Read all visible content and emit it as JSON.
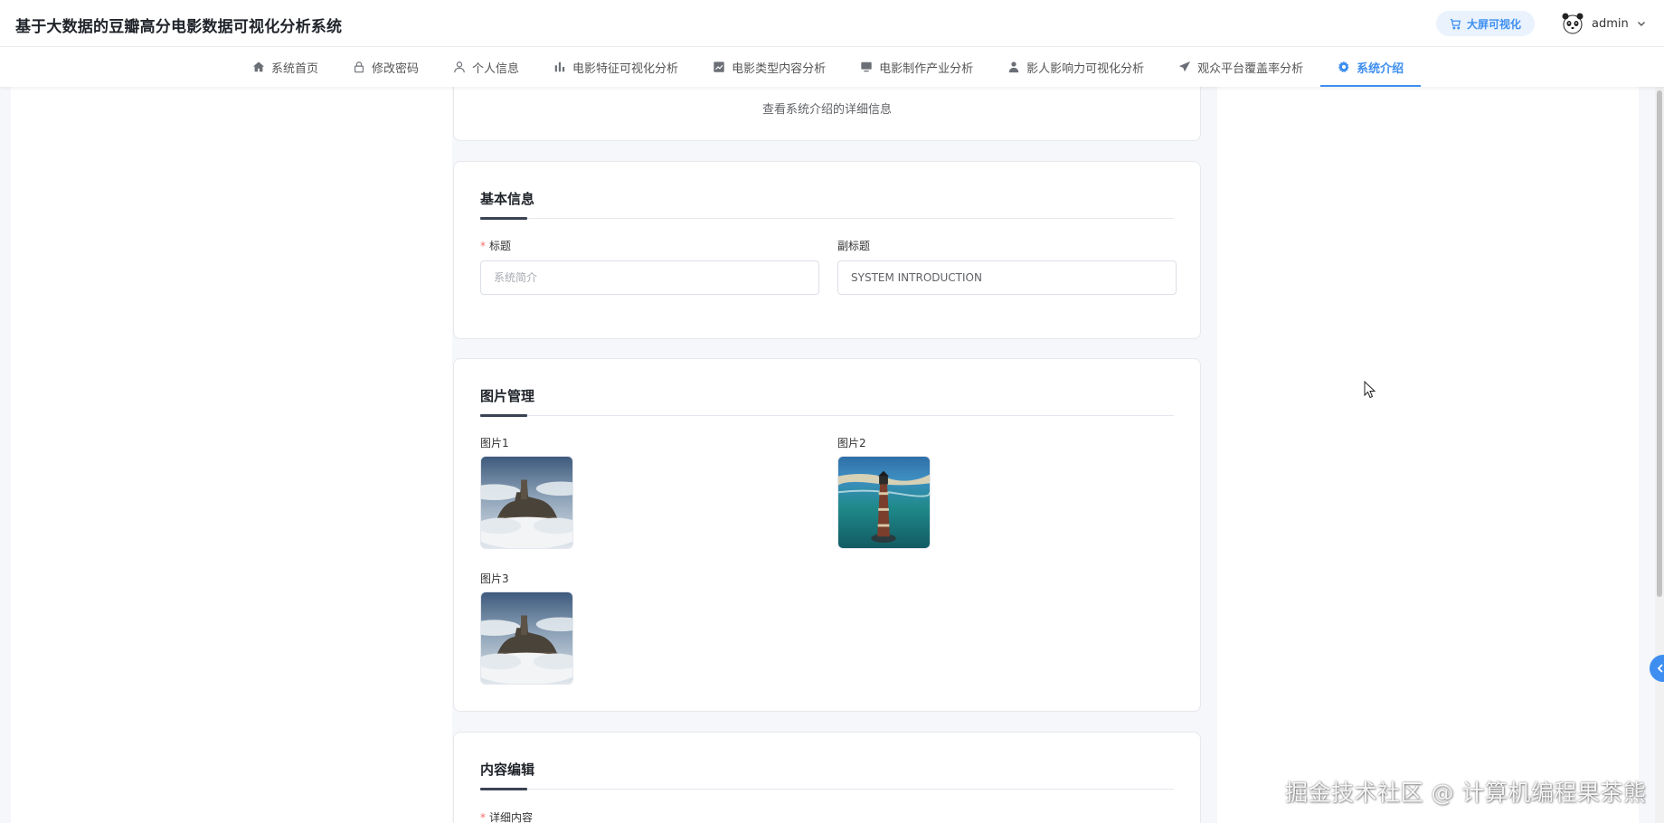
{
  "header": {
    "app_title": "基于大数据的豆瓣高分电影数据可视化分析系统",
    "bigscreen_label": "大屏可视化",
    "username": "admin"
  },
  "nav": {
    "items": [
      {
        "label": "系统首页",
        "icon": "home-icon"
      },
      {
        "label": "修改密码",
        "icon": "lock-icon"
      },
      {
        "label": "个人信息",
        "icon": "user-icon"
      },
      {
        "label": "电影特征可视化分析",
        "icon": "bar-chart-icon"
      },
      {
        "label": "电影类型内容分析",
        "icon": "trend-chart-icon"
      },
      {
        "label": "电影制作产业分析",
        "icon": "monitor-icon"
      },
      {
        "label": "影人影响力可视化分析",
        "icon": "person-icon"
      },
      {
        "label": "观众平台覆盖率分析",
        "icon": "send-icon"
      },
      {
        "label": "系统介绍",
        "icon": "gear-icon",
        "active": true
      }
    ]
  },
  "intro_card": {
    "subtitle": "查看系统介绍的详细信息"
  },
  "basic_info": {
    "title": "基本信息",
    "title_label": "标题",
    "title_placeholder": "系统简介",
    "subtitle_label": "副标题",
    "subtitle_value": "SYSTEM INTRODUCTION"
  },
  "image_mgmt": {
    "title": "图片管理",
    "images": [
      {
        "label": "图片1",
        "subject": "hilltop-town-in-clouds"
      },
      {
        "label": "图片2",
        "subject": "lighthouse-at-sea"
      },
      {
        "label": "图片3",
        "subject": "hilltop-town-in-clouds"
      }
    ]
  },
  "content_edit": {
    "title": "内容编辑",
    "detail_label": "详细内容"
  },
  "watermark": "掘金技术社区 @ 计算机编程果茶熊",
  "colors": {
    "accent": "#3d8ef0",
    "required": "#f56c6c"
  }
}
